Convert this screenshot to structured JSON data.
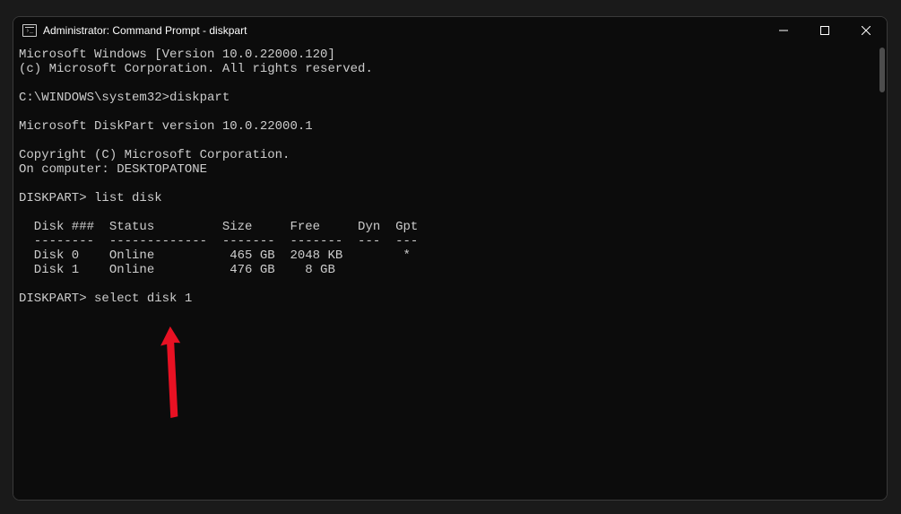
{
  "window": {
    "title": "Administrator: Command Prompt - diskpart"
  },
  "terminal": {
    "line1": "Microsoft Windows [Version 10.0.22000.120]",
    "line2": "(c) Microsoft Corporation. All rights reserved.",
    "blank1": "",
    "line3": "C:\\WINDOWS\\system32>diskpart",
    "blank2": "",
    "line4": "Microsoft DiskPart version 10.0.22000.1",
    "blank3": "",
    "line5": "Copyright (C) Microsoft Corporation.",
    "line6": "On computer: DESKTOPATONE",
    "blank4": "",
    "line7": "DISKPART> list disk",
    "blank5": "",
    "tableHeader": "  Disk ###  Status         Size     Free     Dyn  Gpt",
    "tableDivider": "  --------  -------------  -------  -------  ---  ---",
    "tableRow1": "  Disk 0    Online          465 GB  2048 KB        *",
    "tableRow2": "  Disk 1    Online          476 GB    8 GB",
    "blank6": "",
    "line8": "DISKPART> select disk 1"
  }
}
